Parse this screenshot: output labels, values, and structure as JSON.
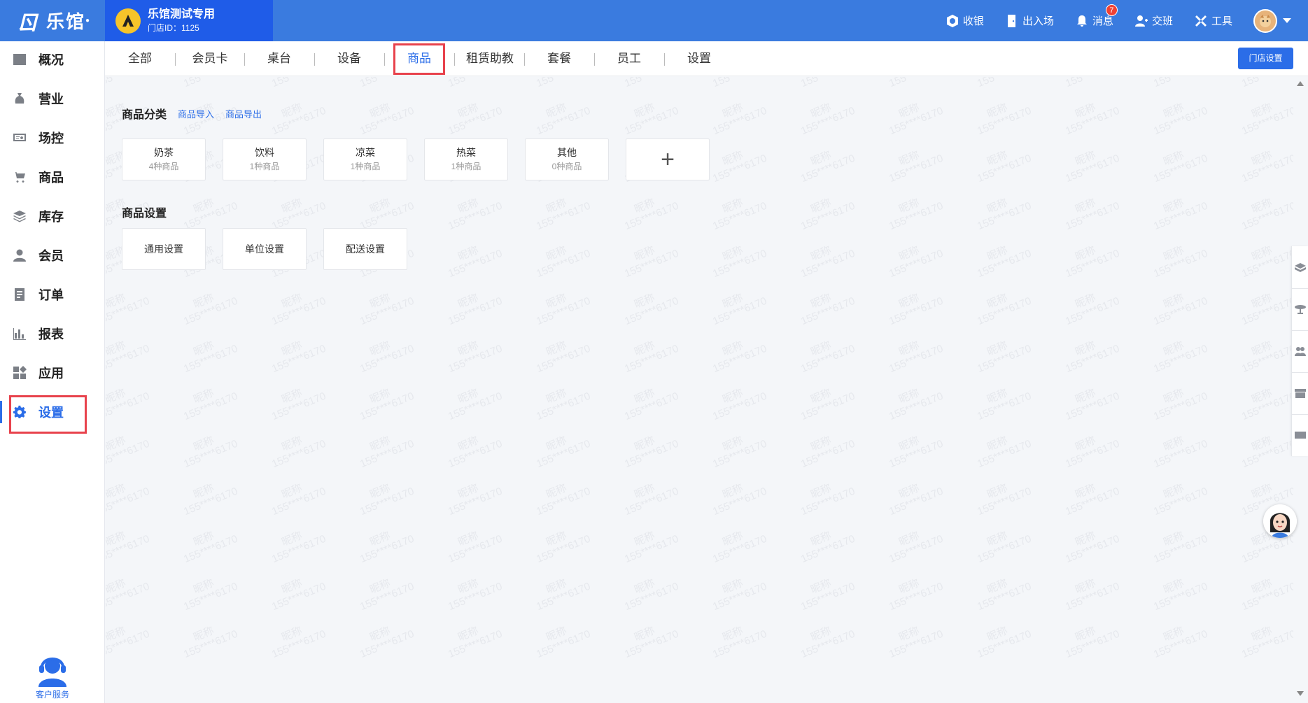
{
  "app": {
    "logo_text": "乐馆",
    "store_name": "乐馆测试专用",
    "store_id_text": "门店ID：1125"
  },
  "header": {
    "actions": [
      {
        "label": "收银",
        "icon": "cashier-icon"
      },
      {
        "label": "出入场",
        "icon": "door-icon"
      },
      {
        "label": "消息",
        "icon": "bell-icon",
        "badge": "7"
      },
      {
        "label": "交班",
        "icon": "handover-icon"
      },
      {
        "label": "工具",
        "icon": "tools-icon"
      }
    ]
  },
  "sidebar": {
    "items": [
      {
        "label": "概况",
        "icon": "chart-icon"
      },
      {
        "label": "营业",
        "icon": "money-bag-icon"
      },
      {
        "label": "场控",
        "icon": "venue-control-icon"
      },
      {
        "label": "商品",
        "icon": "cart-icon"
      },
      {
        "label": "库存",
        "icon": "layers-icon"
      },
      {
        "label": "会员",
        "icon": "user-icon"
      },
      {
        "label": "订单",
        "icon": "order-icon"
      },
      {
        "label": "报表",
        "icon": "bar-chart-icon"
      },
      {
        "label": "应用",
        "icon": "apps-icon"
      },
      {
        "label": "设置",
        "icon": "gear-icon",
        "active": true
      }
    ],
    "support_label": "客户服务"
  },
  "tabs": {
    "items": [
      "全部",
      "会员卡",
      "桌台",
      "设备",
      "商品",
      "租赁助教",
      "套餐",
      "员工",
      "设置"
    ],
    "active": "商品",
    "store_settings_label": "门店设置"
  },
  "main": {
    "category_title": "商品分类",
    "import_label": "商品导入",
    "export_label": "商品导出",
    "categories": [
      {
        "name": "奶茶",
        "count": "4种商品"
      },
      {
        "name": "饮料",
        "count": "1种商品"
      },
      {
        "name": "凉菜",
        "count": "1种商品"
      },
      {
        "name": "热菜",
        "count": "1种商品"
      },
      {
        "name": "其他",
        "count": "0种商品"
      }
    ],
    "add_symbol": "+",
    "settings_title": "商品设置",
    "settings": [
      "通用设置",
      "单位设置",
      "配送设置"
    ]
  },
  "watermark": {
    "line1": "昵称",
    "line2": "155****6170"
  },
  "colors": {
    "primary": "#2b6de8",
    "topbar": "#3a7bdf",
    "store_block": "#1f5ce8",
    "highlight": "#e8424c",
    "badge": "#f04134"
  }
}
